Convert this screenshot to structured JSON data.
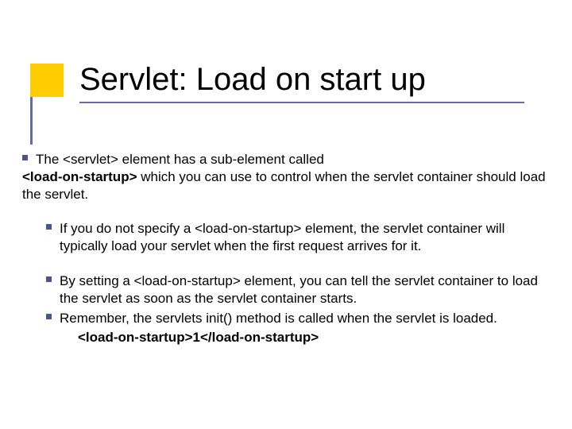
{
  "slide": {
    "title": "Servlet: Load on start up",
    "bullets": {
      "b1_part1": "The <servlet> element has a sub-element called",
      "b1_part2_bold": "<load-on-startup>",
      "b1_part3": " which you can use to control when the servlet container should load the servlet.",
      "b2": "If you do not specify a <load-on-startup> element, the servlet container will typically load your servlet when the first request arrives for it.",
      "b3": "By setting a <load-on-startup> element, you can tell the servlet container to load the servlet as soon as the servlet container starts.",
      "b4": "Remember, the servlets init() method is called when the servlet is loaded.",
      "code": "<load-on-startup>1</load-on-startup>"
    }
  }
}
